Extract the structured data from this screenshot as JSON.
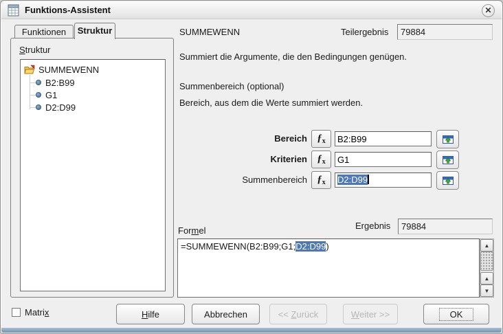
{
  "window": {
    "title": "Funktions-Assistent",
    "close_glyph": "✕"
  },
  "tabs": [
    {
      "label": "Funktionen"
    },
    {
      "label": "Struktur"
    }
  ],
  "structure_panel": {
    "label": {
      "accel": "S",
      "post": "truktur"
    },
    "tree": {
      "root": "SUMMEWENN",
      "children": [
        "B2:B99",
        "G1",
        "D2:D99"
      ]
    }
  },
  "function": {
    "name": "SUMMEWENN",
    "partial_result_label": "Teilergebnis",
    "partial_result_value": "79884",
    "description": "Summiert die Argumente, die den Bedingungen genügen.",
    "arg_title": "Summenbereich (optional)",
    "arg_description": "Bereich, aus dem die Werte summiert werden."
  },
  "args": [
    {
      "label": "Bereich",
      "value": "B2:B99"
    },
    {
      "label": "Kriterien",
      "value": "G1"
    },
    {
      "label": "Summenbereich",
      "value": "D2:D99"
    }
  ],
  "formula": {
    "label": {
      "pre": "For",
      "accel": "m",
      "post": "el"
    },
    "result_label": "Ergebnis",
    "result_value": "79884",
    "pre": "=SUMMEWENN(B2:B99;G1;",
    "selected": "D2:D99",
    "post": ")"
  },
  "footer": {
    "matrix": {
      "pre": "Matri",
      "accel": "x"
    },
    "help": {
      "accel": "H",
      "post": "ilfe"
    },
    "cancel_label": "Abbrechen",
    "back": {
      "pre": "<< ",
      "accel": "Z",
      "post": "urück"
    },
    "next": {
      "accel": "W",
      "post": "eiter >>"
    },
    "ok_label": "OK"
  },
  "icons": {
    "fx_f": "ƒ",
    "fx_x": "x",
    "scroll_up": "▲",
    "scroll_down": "▼"
  },
  "colors": {
    "selection_blue": "#4d77b5",
    "shrink_titlebar_blue": "#2f6bd8",
    "shrink_arrow_green": "#3cae3c",
    "folder_yellow": "#f6c645"
  }
}
